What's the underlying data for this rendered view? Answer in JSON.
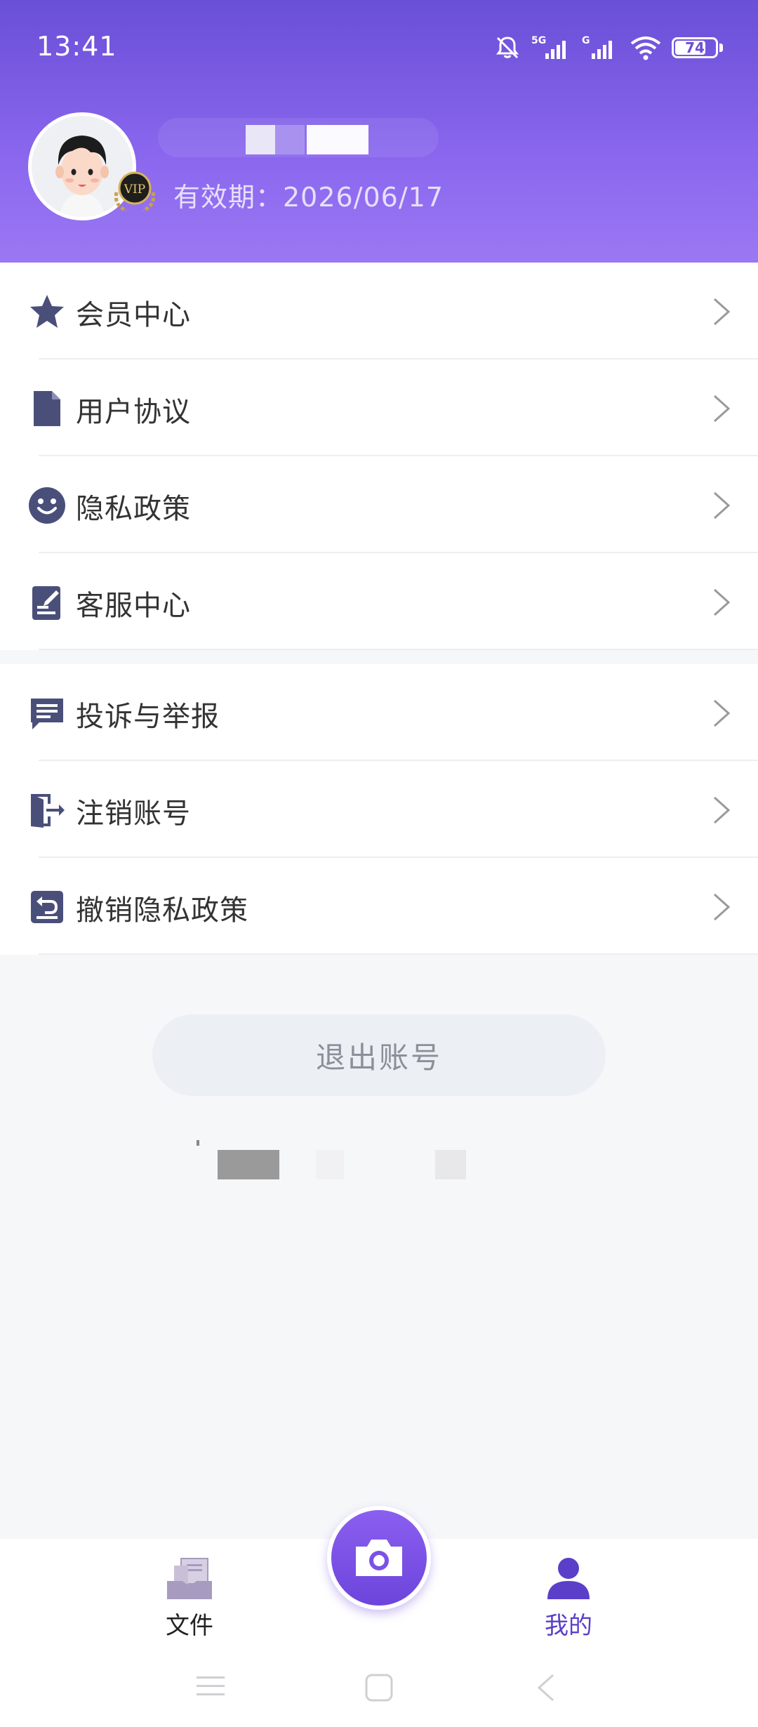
{
  "status_bar": {
    "time": "13:41",
    "network_1": "5G",
    "network_2": "G",
    "battery": "74",
    "icons": [
      "bell-mute-icon",
      "signal-5g-icon",
      "signal-g-icon",
      "wifi-icon",
      "battery-icon"
    ]
  },
  "profile": {
    "avatar": "avatar-icon",
    "vip_badge": "VIP",
    "expiry": "有效期：2026/06/17"
  },
  "menu": {
    "group1": [
      {
        "label": "会员中心",
        "icon": "star-icon"
      },
      {
        "label": "用户协议",
        "icon": "document-icon"
      },
      {
        "label": "隐私政策",
        "icon": "smile-icon"
      },
      {
        "label": "客服中心",
        "icon": "edit-note-icon"
      }
    ],
    "group2": [
      {
        "label": "投诉与举报",
        "icon": "chat-message-icon"
      },
      {
        "label": "注销账号",
        "icon": "exit-door-icon"
      },
      {
        "label": "撤销隐私政策",
        "icon": "undo-list-icon"
      }
    ]
  },
  "logout_label": "退出账号",
  "bottom_nav": {
    "files_label": "文件",
    "mine_label": "我的",
    "active_tab": "我的"
  },
  "colors": {
    "header_top": "#6a4fd7",
    "header_bottom": "#9b78f3",
    "accent": "#5b3fc9",
    "icon": "#4a4f7a"
  }
}
